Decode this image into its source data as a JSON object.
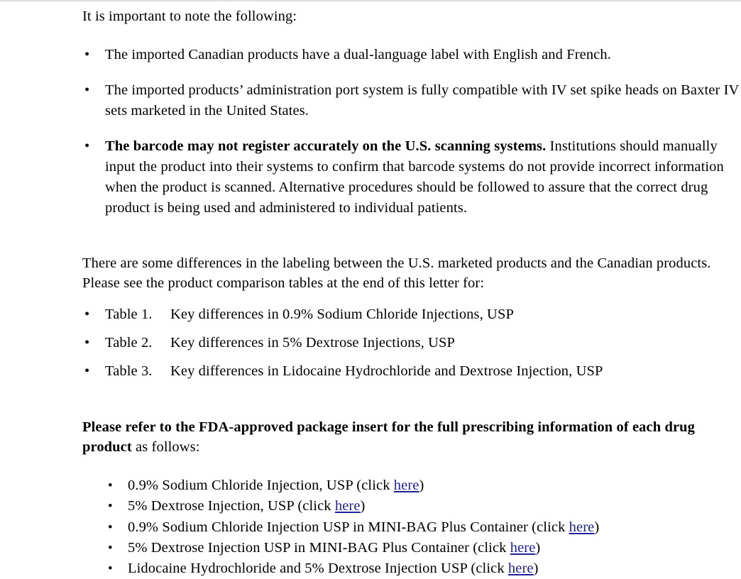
{
  "document": {
    "intro": "It is important to note the following:",
    "notes": [
      {
        "text": "The imported Canadian products have a dual-language label with English and French.",
        "bold_lead": ""
      },
      {
        "text": "The imported products’ administration port system is fully compatible with IV set spike heads on Baxter IV sets marketed in the United States.",
        "bold_lead": ""
      },
      {
        "bold_lead": "The barcode may not register accurately on the U.S. scanning systems.",
        "text": " Institutions should manually input the product into their systems to confirm that barcode systems do not provide incorrect information when the product is scanned. Alternative procedures should be followed to assure that the correct drug product is being used and administered to individual patients."
      }
    ],
    "differences_para": "There are some differences in the labeling between the U.S. marketed products and the Canadian products.  Please see the product comparison tables at the end of this letter for:",
    "tables": [
      {
        "number": "Table 1.",
        "description": "Key differences in 0.9% Sodium Chloride Injections, USP"
      },
      {
        "number": "Table 2.",
        "description": "Key differences in 5% Dextrose Injections, USP"
      },
      {
        "number": "Table 3.",
        "description": "Key differences in Lidocaine Hydrochloride and Dextrose Injection, USP"
      }
    ],
    "insert_heading_bold": "Please refer to the FDA-approved package insert for the full prescribing information of each drug product",
    "insert_heading_rest": " as follows:",
    "products": [
      {
        "name": "0.9% Sodium Chloride Injection, USP (click ",
        "link": "here",
        "suffix": ")"
      },
      {
        "name": "5% Dextrose Injection, USP (click ",
        "link": "here",
        "suffix": ")"
      },
      {
        "name": "0.9% Sodium Chloride Injection USP in MINI-BAG Plus Container (click ",
        "link": "here",
        "suffix": ")"
      },
      {
        "name": "5% Dextrose Injection USP in MINI-BAG Plus Container (click ",
        "link": "here",
        "suffix": ")"
      },
      {
        "name": "Lidocaine Hydrochloride and 5% Dextrose Injection USP (click ",
        "link": "here",
        "suffix": ")"
      }
    ],
    "bullet_glyph": "•",
    "link_color": "#20209a",
    "text_color": "#000000",
    "background_color": "#ffffff"
  }
}
